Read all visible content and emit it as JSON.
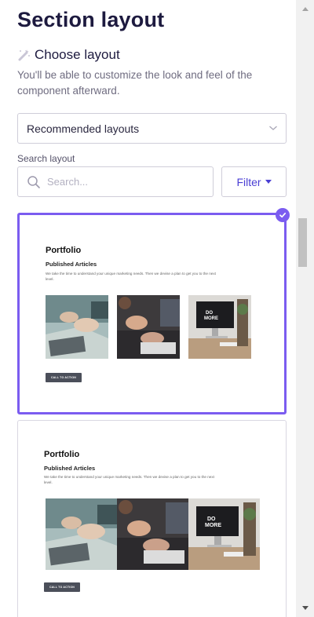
{
  "header": {
    "title": "Section layout"
  },
  "choose": {
    "title": "Choose layout",
    "description": "You'll be able to customize the look and feel of the component afterward."
  },
  "layout_select": {
    "value": "Recommended layouts"
  },
  "search": {
    "label": "Search layout",
    "placeholder": "Search..."
  },
  "filter": {
    "label": "Filter"
  },
  "cards": [
    {
      "selected": true,
      "title": "Portfolio",
      "subtitle": "Published Articles",
      "text": "We take the time to understand your unique marketing needs. Then we devise a plan to get you to the next level.",
      "cta": "CALL TO ACTION",
      "images": [
        "laptop-hands-photo",
        "meeting-hands-photo",
        "desk-monitor-photo"
      ]
    },
    {
      "selected": false,
      "title": "Portfolio",
      "subtitle": "Published Articles",
      "text": "We take the time to understand your unique marketing needs. Then we devise a plan to get you to the next level.",
      "cta": "CALL TO ACTION",
      "images": [
        "laptop-hands-photo",
        "meeting-hands-photo",
        "desk-monitor-photo"
      ]
    }
  ],
  "icons": {
    "wand": "magic-wand-icon",
    "search": "search-icon",
    "chevron": "chevron-down-icon",
    "check": "check-circle-icon"
  },
  "colors": {
    "accent": "#7b5cf0",
    "filter_text": "#4a3fd4",
    "title": "#1d1a3f"
  }
}
